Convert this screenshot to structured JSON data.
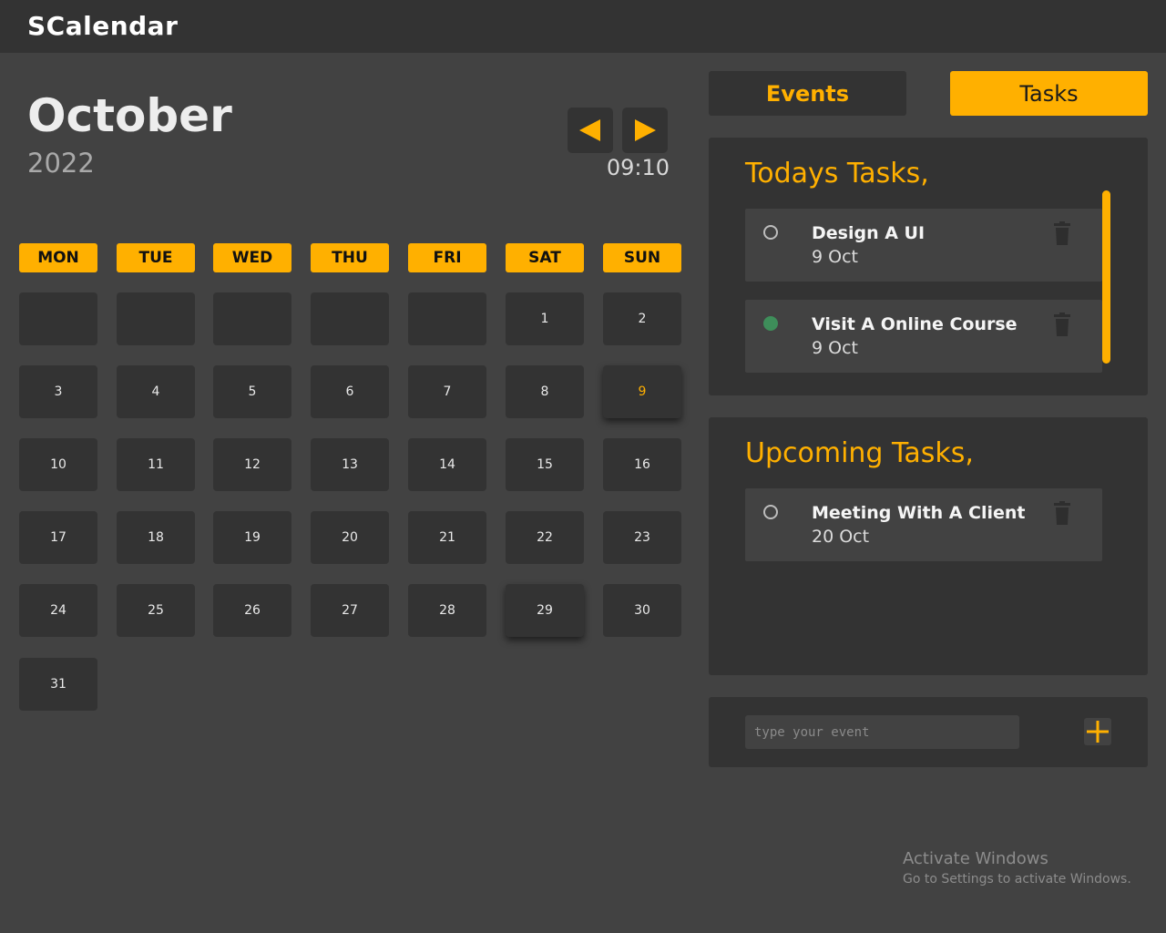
{
  "app": {
    "title": "SCalendar"
  },
  "calendar": {
    "month": "October",
    "year": "2022",
    "time": "09:10",
    "weekdays": [
      "MON",
      "TUE",
      "WED",
      "THU",
      "FRI",
      "SAT",
      "SUN"
    ],
    "days": [
      "1",
      "2",
      "3",
      "4",
      "5",
      "6",
      "7",
      "8",
      "9",
      "10",
      "11",
      "12",
      "13",
      "14",
      "15",
      "16",
      "17",
      "18",
      "19",
      "20",
      "21",
      "22",
      "23",
      "24",
      "25",
      "26",
      "27",
      "28",
      "29",
      "30",
      "31"
    ],
    "today": "9"
  },
  "tabs": {
    "events": "Events",
    "tasks": "Tasks"
  },
  "today_tasks": {
    "title": "Todays Tasks,",
    "items": [
      {
        "name": "Design A UI",
        "date": "9 Oct",
        "done": false
      },
      {
        "name": "Visit A Online Course",
        "date": "9 Oct",
        "done": true
      }
    ]
  },
  "upcoming_tasks": {
    "title": "Upcoming Tasks,",
    "items": [
      {
        "name": "Meeting With A Client",
        "date": "20 Oct",
        "done": false
      }
    ]
  },
  "input": {
    "placeholder": "type your event"
  },
  "watermark": {
    "title": "Activate Windows",
    "subtitle": "Go to Settings to activate Windows."
  },
  "colors": {
    "accent": "#FFB000",
    "panel": "#333333",
    "background": "#424242",
    "done": "#3e8e5a"
  },
  "icons": {
    "prev": "triangle-left-icon",
    "next": "triangle-right-icon",
    "delete": "trash-icon",
    "add": "plus-icon"
  }
}
